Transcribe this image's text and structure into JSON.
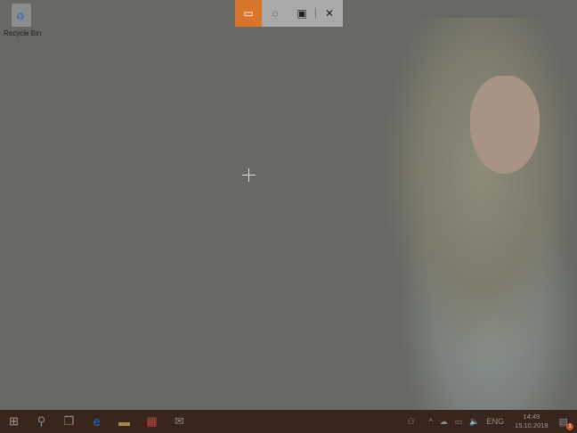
{
  "desktop": {
    "recycle_bin_label": "Recycle Bin"
  },
  "snip_toolbar": {
    "buttons": [
      {
        "name": "rectangular-snip",
        "glyph": "▭",
        "active": true
      },
      {
        "name": "freeform-snip",
        "glyph": "◌"
      },
      {
        "name": "fullscreen-snip",
        "glyph": "▣"
      }
    ],
    "close_glyph": "✕",
    "accent": "#d9742b"
  },
  "taskbar": {
    "apps": [
      {
        "name": "start",
        "glyph": "⊞"
      },
      {
        "name": "search",
        "glyph": "⚲"
      },
      {
        "name": "task-view",
        "glyph": "❐"
      },
      {
        "name": "edge",
        "glyph": "e"
      },
      {
        "name": "file-explorer",
        "glyph": "▬"
      },
      {
        "name": "store",
        "glyph": "▦"
      },
      {
        "name": "mail",
        "glyph": "✉"
      }
    ],
    "tray": {
      "people": "⚇",
      "chevron": "^",
      "onedrive": "☁",
      "network": "▭",
      "volume": "🔈",
      "language": "ENG",
      "time": "14:49",
      "date": "15.10.2018",
      "notification_badge": "1",
      "action_center": "▤"
    }
  }
}
